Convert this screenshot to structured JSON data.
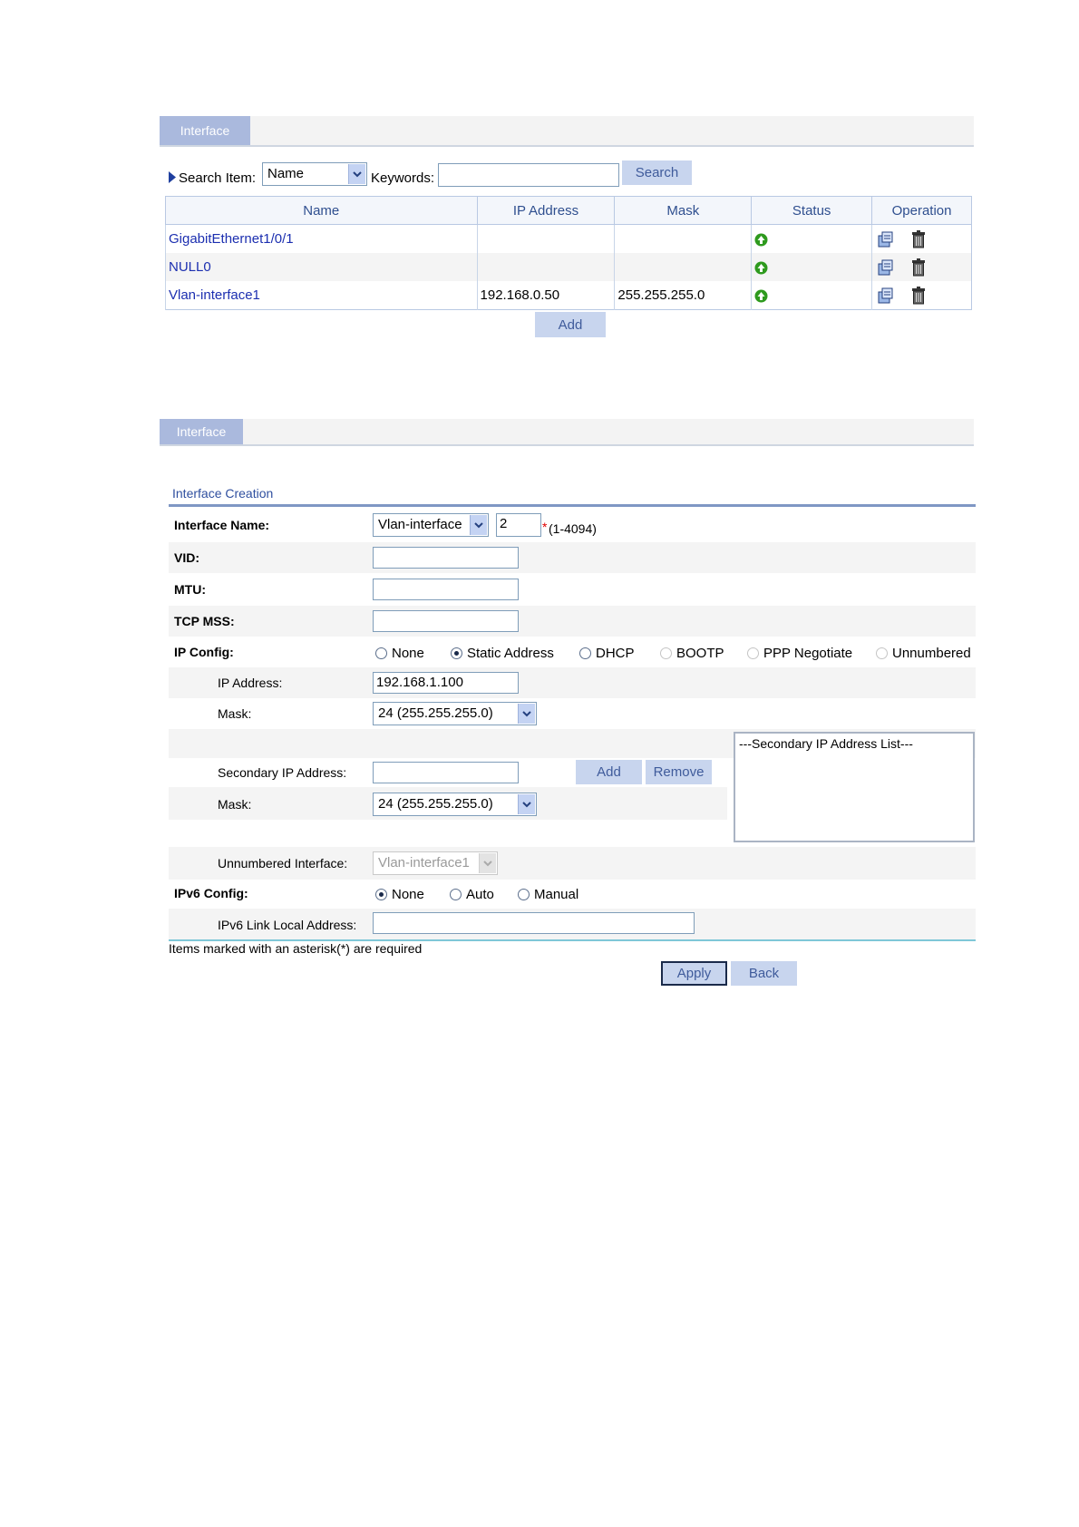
{
  "list_panel": {
    "tab_label": "Interface",
    "search_item_label": "Search Item:",
    "search_item_value": "Name",
    "keywords_label": "Keywords:",
    "keywords_value": "",
    "search_button": "Search",
    "columns": [
      "Name",
      "IP Address",
      "Mask",
      "Status",
      "Operation"
    ],
    "rows": [
      {
        "name": "GigabitEthernet1/0/1",
        "ip": "",
        "mask": ""
      },
      {
        "name": "NULL0",
        "ip": "",
        "mask": ""
      },
      {
        "name": "Vlan-interface1",
        "ip": "192.168.0.50",
        "mask": "255.255.255.0"
      }
    ],
    "add_button": "Add"
  },
  "form_panel": {
    "tab_label": "Interface",
    "section_title": "Interface Creation",
    "interface_name_label": "Interface Name:",
    "interface_type_value": "Vlan-interface",
    "interface_number_value": "2",
    "required_mark": "*",
    "number_range": "(1-4094)",
    "vid_label": "VID:",
    "mtu_label": "MTU:",
    "tcp_mss_label": "TCP MSS:",
    "ip_config_label": "IP Config:",
    "ip_config_options": [
      "None",
      "Static Address",
      "DHCP",
      "BOOTP",
      "PPP Negotiate",
      "Unnumbered"
    ],
    "ip_config_selected": "Static Address",
    "ip_address_label": "IP Address:",
    "ip_address_value": "192.168.1.100",
    "mask_label": "Mask:",
    "mask_value": "24 (255.255.255.0)",
    "secondary_ip_label": "Secondary IP Address:",
    "secondary_ip_value": "",
    "secondary_add_button": "Add",
    "secondary_remove_button": "Remove",
    "secondary_list_header": "---Secondary IP Address List---",
    "secondary_mask_label": "Mask:",
    "secondary_mask_value": "24 (255.255.255.0)",
    "unnumbered_label": "Unnumbered Interface:",
    "unnumbered_value": "Vlan-interface1",
    "ipv6_config_label": "IPv6 Config:",
    "ipv6_options": [
      "None",
      "Auto",
      "Manual"
    ],
    "ipv6_selected": "None",
    "ipv6_link_local_label": "IPv6 Link Local Address:",
    "required_note": "Items marked with an asterisk(*) are required",
    "apply_button": "Apply",
    "back_button": "Back"
  },
  "colors": {
    "tab_bg": "#aab9dd",
    "link": "#1c2fb0",
    "status_up": "#2e9a1e",
    "button_bg": "#c8d5ee",
    "required": "#e00000"
  }
}
